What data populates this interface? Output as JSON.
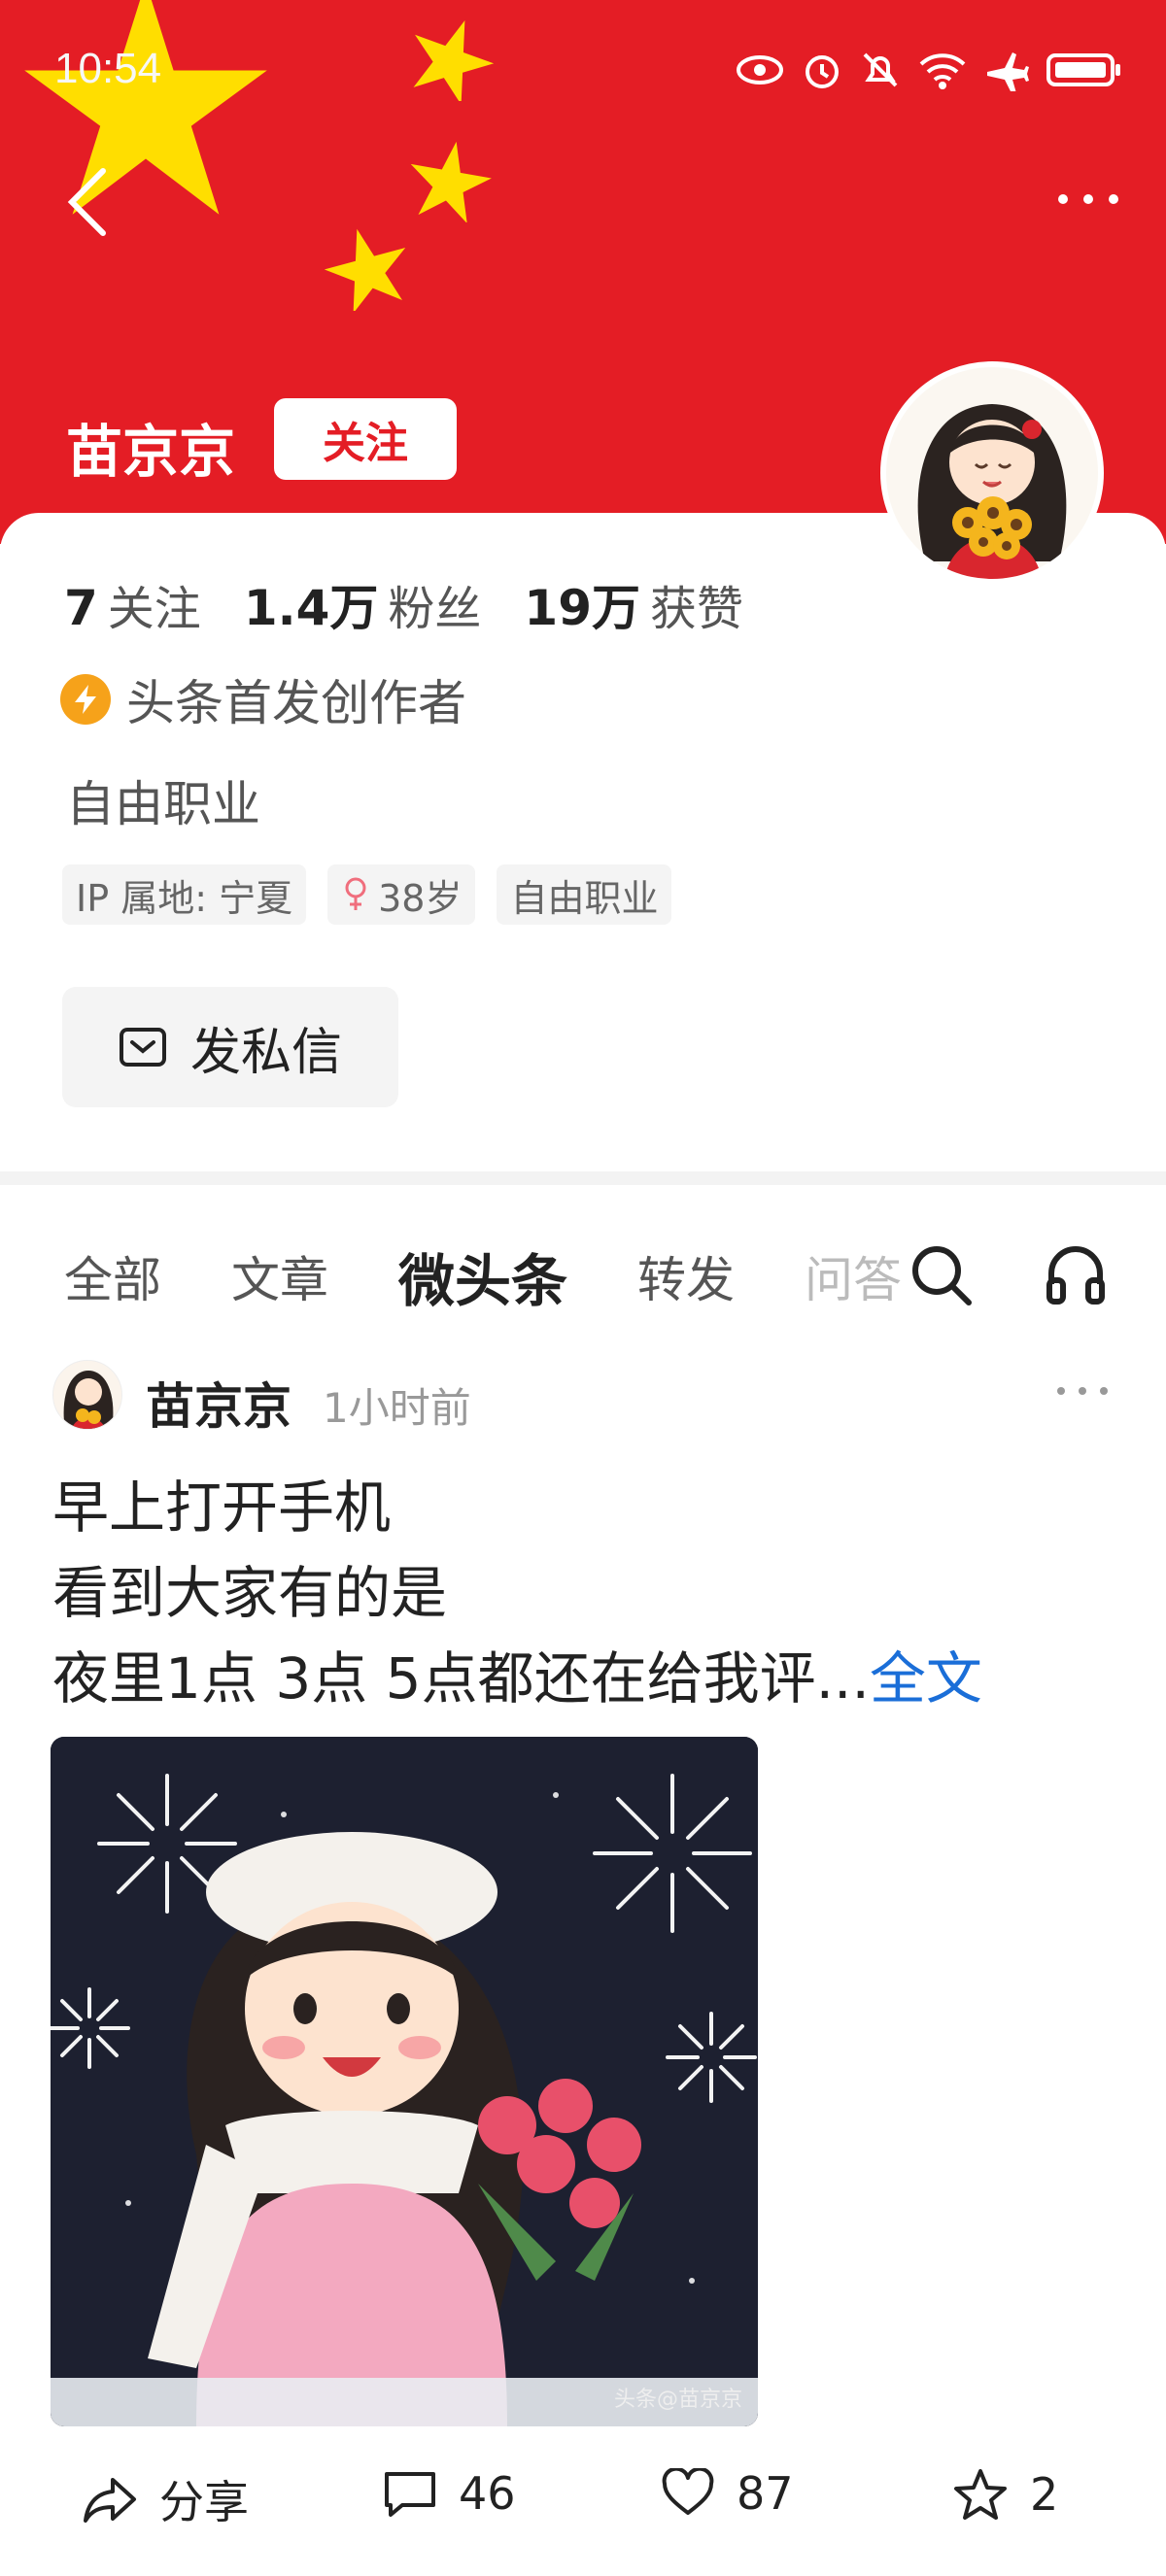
{
  "status": {
    "time": "10:54"
  },
  "profile": {
    "name": "苗京京",
    "follow_label": "关注",
    "stats": [
      {
        "num": "7",
        "label": "关注"
      },
      {
        "num": "1.4万",
        "label": "粉丝"
      },
      {
        "num": "19万",
        "label": "获赞"
      }
    ],
    "creator_badge": "头条首发创作者",
    "bio": "自由职业",
    "tags": [
      "IP 属地: 宁夏",
      "38岁",
      "自由职业"
    ],
    "dm_label": "发私信"
  },
  "tabs": {
    "items": [
      "全部",
      "文章",
      "微头条",
      "转发",
      "问答"
    ],
    "active": "微头条"
  },
  "post": {
    "author": "苗京京",
    "time": "1小时前",
    "lines": [
      "早上打开手机",
      "看到大家有的是",
      "夜里1点 3点 5点都还在给我评..."
    ],
    "full_label": "全文",
    "watermark": "头条@苗京京",
    "actions": {
      "share": "分享",
      "comments": "46",
      "likes": "87",
      "favorites": "2"
    }
  },
  "colors": {
    "banner": "#e41d25",
    "star": "#ffde00",
    "link": "#1a6ed8"
  }
}
